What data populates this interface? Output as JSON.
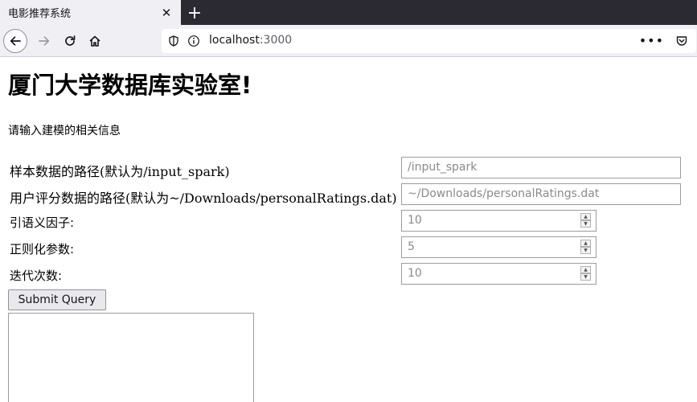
{
  "browser": {
    "tab_title": "电影推荐系统",
    "tab_close": "✕",
    "new_tab": "+",
    "url_host": "localhost",
    "url_port": ":3000",
    "url_more": "•••"
  },
  "page": {
    "heading": "厦门大学数据库实验室!",
    "intro": "请输入建模的相关信息",
    "fields": [
      {
        "label": "样本数据的路径(默认为/input_spark)",
        "placeholder": "/input_spark"
      },
      {
        "label": "用户评分数据的路径(默认为~/Downloads/personalRatings.dat)",
        "placeholder": "~/Downloads/personalRatings.dat"
      },
      {
        "label": "引语义因子:",
        "placeholder": "10"
      },
      {
        "label": "正则化参数:",
        "placeholder": "5"
      },
      {
        "label": "迭代次数:",
        "placeholder": "10"
      }
    ],
    "submit_label": "Submit Query"
  }
}
